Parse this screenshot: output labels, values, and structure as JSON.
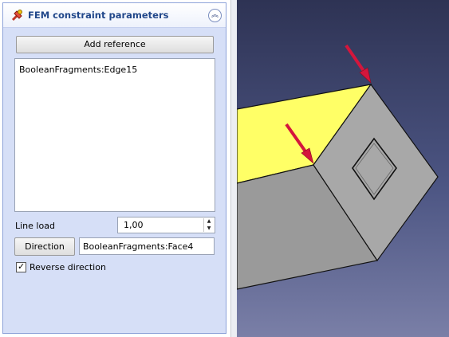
{
  "panel": {
    "title": "FEM constraint parameters",
    "collapse_glyph": "︽",
    "add_reference_label": "Add reference",
    "references": [
      "BooleanFragments:Edge15"
    ],
    "line_load_label": "Line load",
    "line_load_value": "1,00",
    "spin_up_glyph": "▲",
    "spin_down_glyph": "▼",
    "direction_button_label": "Direction",
    "direction_value": "BooleanFragments:Face4",
    "reverse_direction_label": "Reverse direction",
    "reverse_direction_checked": true,
    "check_glyph": "✓",
    "title_icon": "fem-constraint-icon"
  },
  "viewport": {
    "icons": [
      "load-arrow-icon",
      "load-arrow-icon"
    ],
    "colors": {
      "selected_face": "#ffff66",
      "body_side": "#9a9a9a",
      "body_end": "#a8a8a8",
      "arrow": "#d4163c",
      "background_top": "#2e3354",
      "background_bottom": "#7a7fa7"
    }
  }
}
